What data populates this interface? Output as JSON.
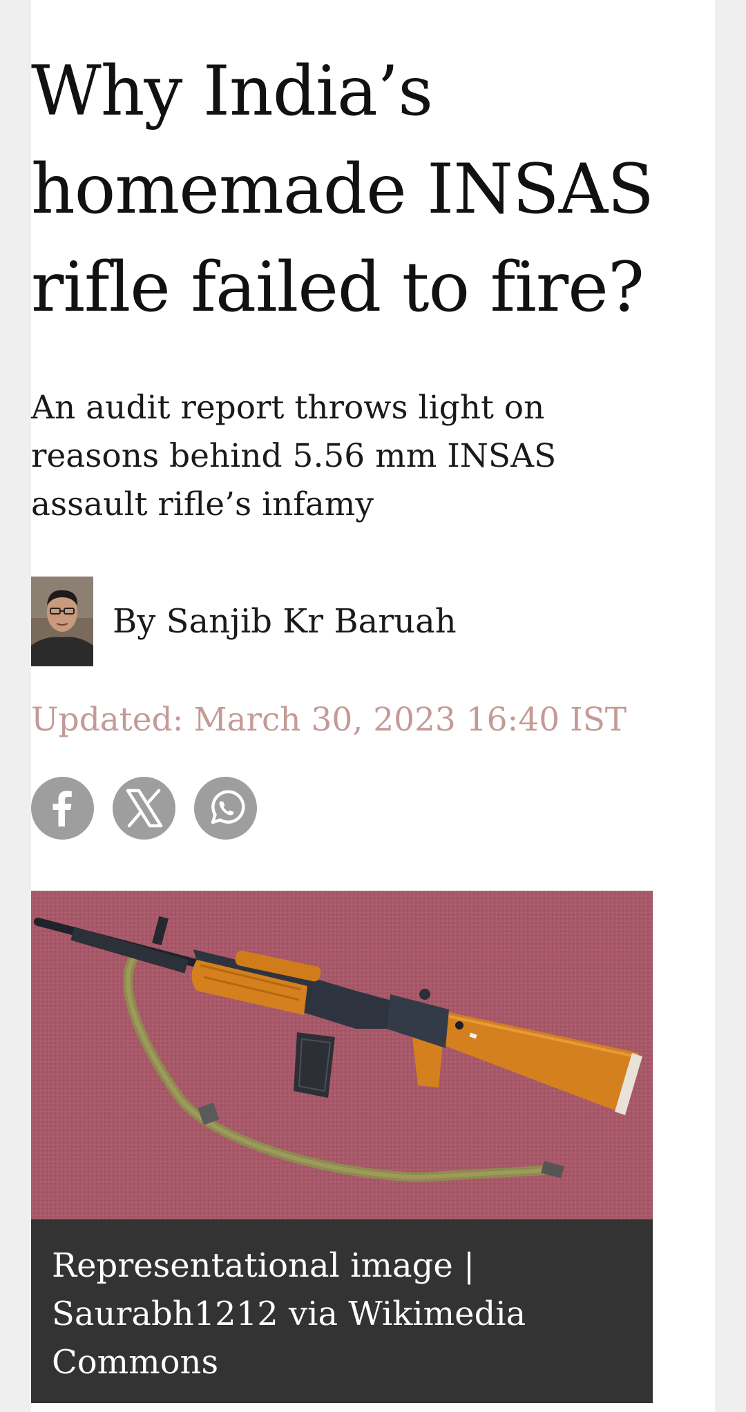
{
  "article": {
    "headline": "Why India’s homemade INSAS rifle failed to fire?",
    "subheadline": "An audit report throws light on reasons behind 5.56 mm INSAS assault rifle’s infamy",
    "author": "By Sanjib Kr Baruah",
    "updated": "Updated: March 30, 2023 16:40 IST",
    "image_caption": "Representational image | Saurabh1212 via Wikimedia Commons"
  },
  "share": {
    "icons": [
      "facebook-icon",
      "x-icon",
      "whatsapp-icon"
    ]
  },
  "colors": {
    "updated_text": "#c49a96",
    "share_bg": "#9e9e9e",
    "caption_bg": "#333333"
  }
}
